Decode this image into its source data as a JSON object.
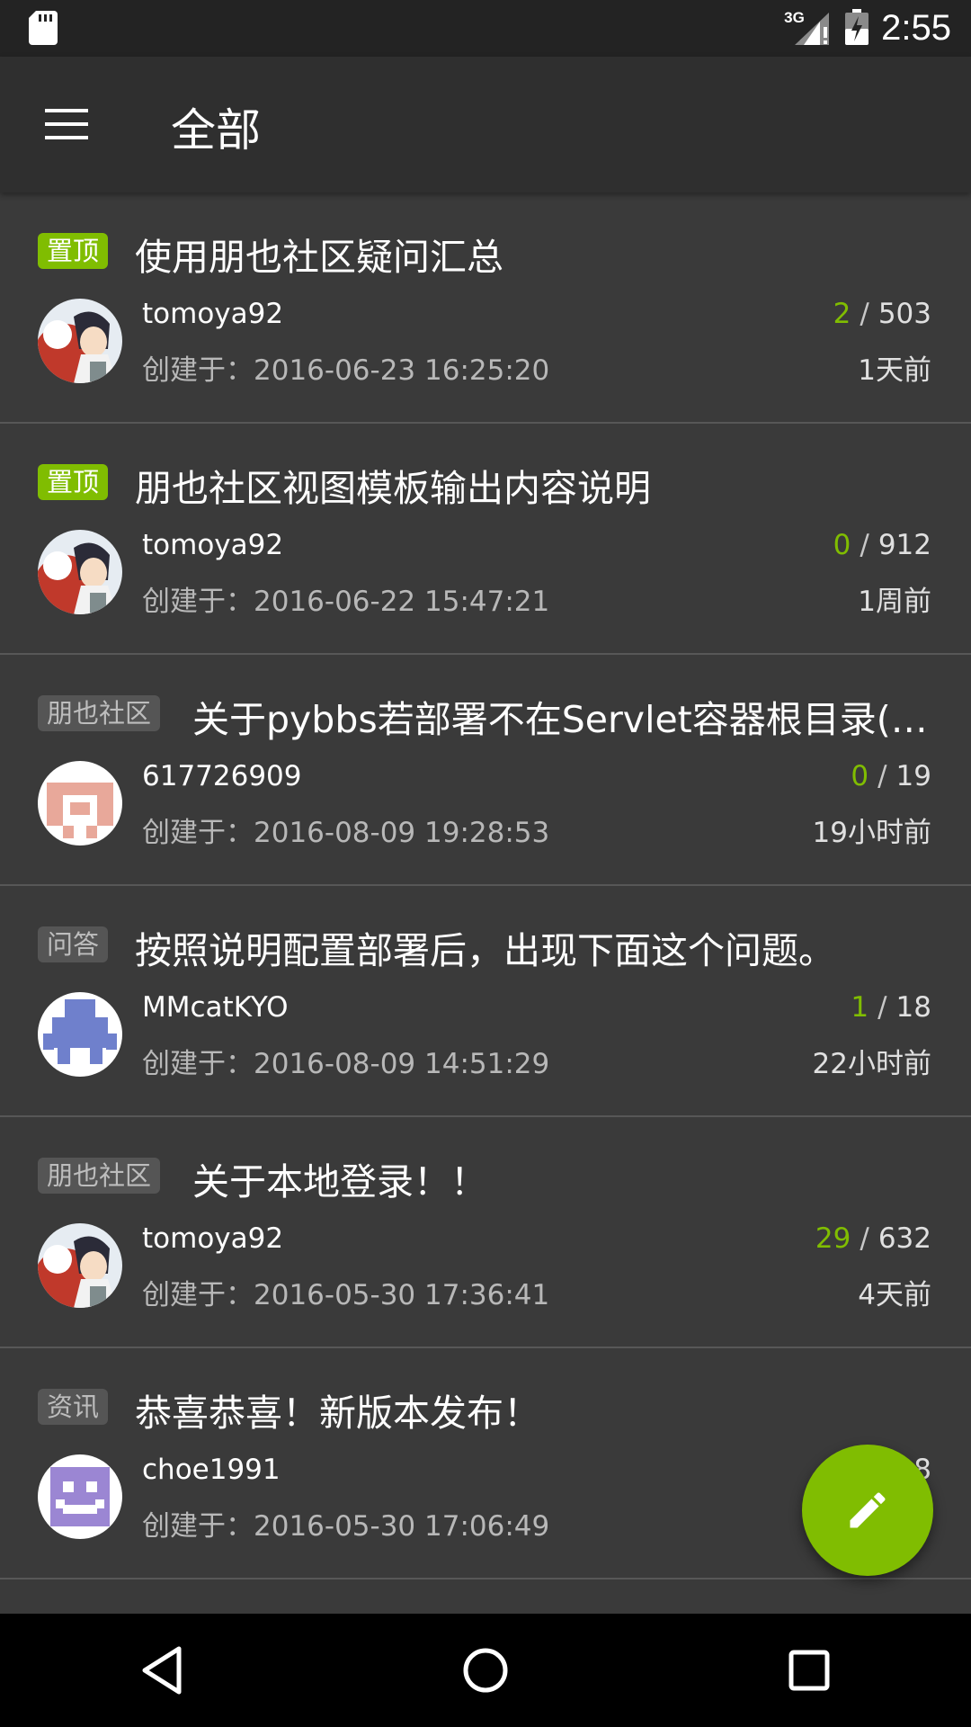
{
  "status_bar": {
    "time": "2:55",
    "network": "3G",
    "icons": [
      "sd-card-icon",
      "signal-icon",
      "battery-icon"
    ]
  },
  "app_bar": {
    "title": "全部",
    "menu_icon": "menu-icon"
  },
  "colors": {
    "accent": "#80bd01",
    "background": "#3a3a3a",
    "app_bar": "#2f2f2f",
    "divider": "#575757"
  },
  "topics": [
    {
      "tag": "置顶",
      "tag_type": "top",
      "title": "使用朋也社区疑问汇总",
      "author": "tomoya92",
      "created": "创建于：2016-06-23 16:25:20",
      "replies": "2",
      "views": "503",
      "ago": "1天前",
      "avatar": "anime-avatar"
    },
    {
      "tag": "置顶",
      "tag_type": "top",
      "title": "朋也社区视图模板输出内容说明",
      "author": "tomoya92",
      "created": "创建于：2016-06-22 15:47:21",
      "replies": "0",
      "views": "912",
      "ago": "1周前",
      "avatar": "anime-avatar"
    },
    {
      "tag": "朋也社区",
      "tag_type": "normal",
      "title": "关于pybbs若部署不在Servlet容器根目录(…",
      "author": "617726909",
      "created": "创建于：2016-08-09 19:28:53",
      "replies": "0",
      "views": "19",
      "ago": "19小时前",
      "avatar": "pink-identicon"
    },
    {
      "tag": "问答",
      "tag_type": "normal",
      "title": "按照说明配置部署后，出现下面这个问题。",
      "author": "MMcatKYO",
      "created": "创建于：2016-08-09 14:51:29",
      "replies": "1",
      "views": "18",
      "ago": "22小时前",
      "avatar": "blue-identicon"
    },
    {
      "tag": "朋也社区",
      "tag_type": "normal",
      "title": "关于本地登录！！",
      "author": "tomoya92",
      "created": "创建于：2016-05-30 17:36:41",
      "replies": "29",
      "views": "632",
      "ago": "4天前",
      "avatar": "anime-avatar"
    },
    {
      "tag": "资讯",
      "tag_type": "normal",
      "title": "恭喜恭喜！新版本发布！",
      "author": "choe1991",
      "created": "创建于：2016-05-30 17:06:49",
      "replies": "",
      "views": "8",
      "ago": "",
      "avatar": "purple-identicon"
    }
  ],
  "fab": {
    "icon": "pencil-icon"
  },
  "nav_bar": {
    "icons": [
      "back-icon",
      "home-icon",
      "recents-icon"
    ]
  }
}
